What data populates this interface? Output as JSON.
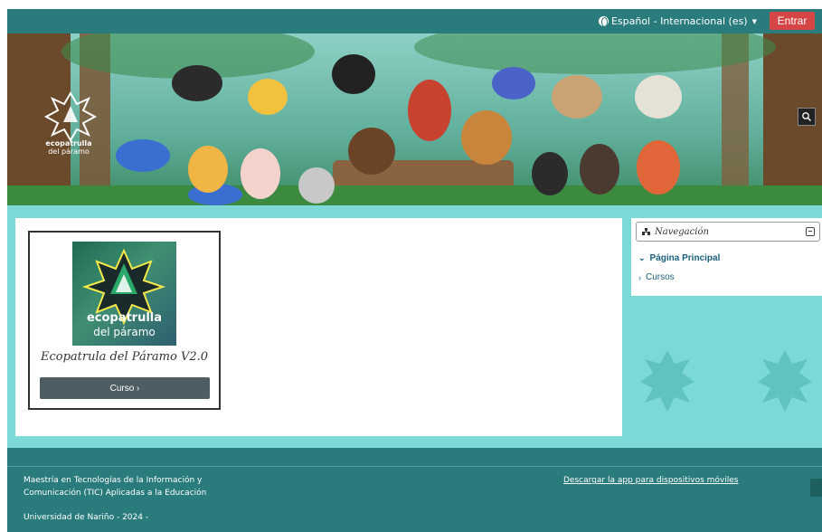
{
  "header": {
    "language_label": "Español - Internacional (es)",
    "login_label": "Entrar"
  },
  "banner": {
    "logo_line1": "ecopatrulla",
    "logo_line2": "del páramo"
  },
  "course": {
    "image_line1": "ecopatrulla",
    "image_line2": "del páramo",
    "title": "Ecopatrula del Páramo V2.0",
    "button_label": "Curso ›"
  },
  "navigation": {
    "title": "Navegación",
    "items": [
      {
        "label": "Página Principal",
        "chevron": "⌄"
      },
      {
        "label": "Cursos",
        "chevron": "›"
      }
    ]
  },
  "footer": {
    "program_line1": "Maestría en Tecnologías de la Información y",
    "program_line2": "Comunicación (TIC) Aplicadas a la Educación",
    "university": "Universidad de Nariño - 2024 -",
    "app_link": "Descargar la app para dispositivos móviles"
  },
  "colors": {
    "topbar": "#2a7b7c",
    "login_button": "#d54545",
    "main_background": "#7dd9d6",
    "course_button": "#4e5d63",
    "link": "#1a5f7a"
  },
  "icons": {
    "language": "globe-icon",
    "search": "search-icon",
    "navigation": "sitemap-icon",
    "collapse": "collapse-icon"
  }
}
